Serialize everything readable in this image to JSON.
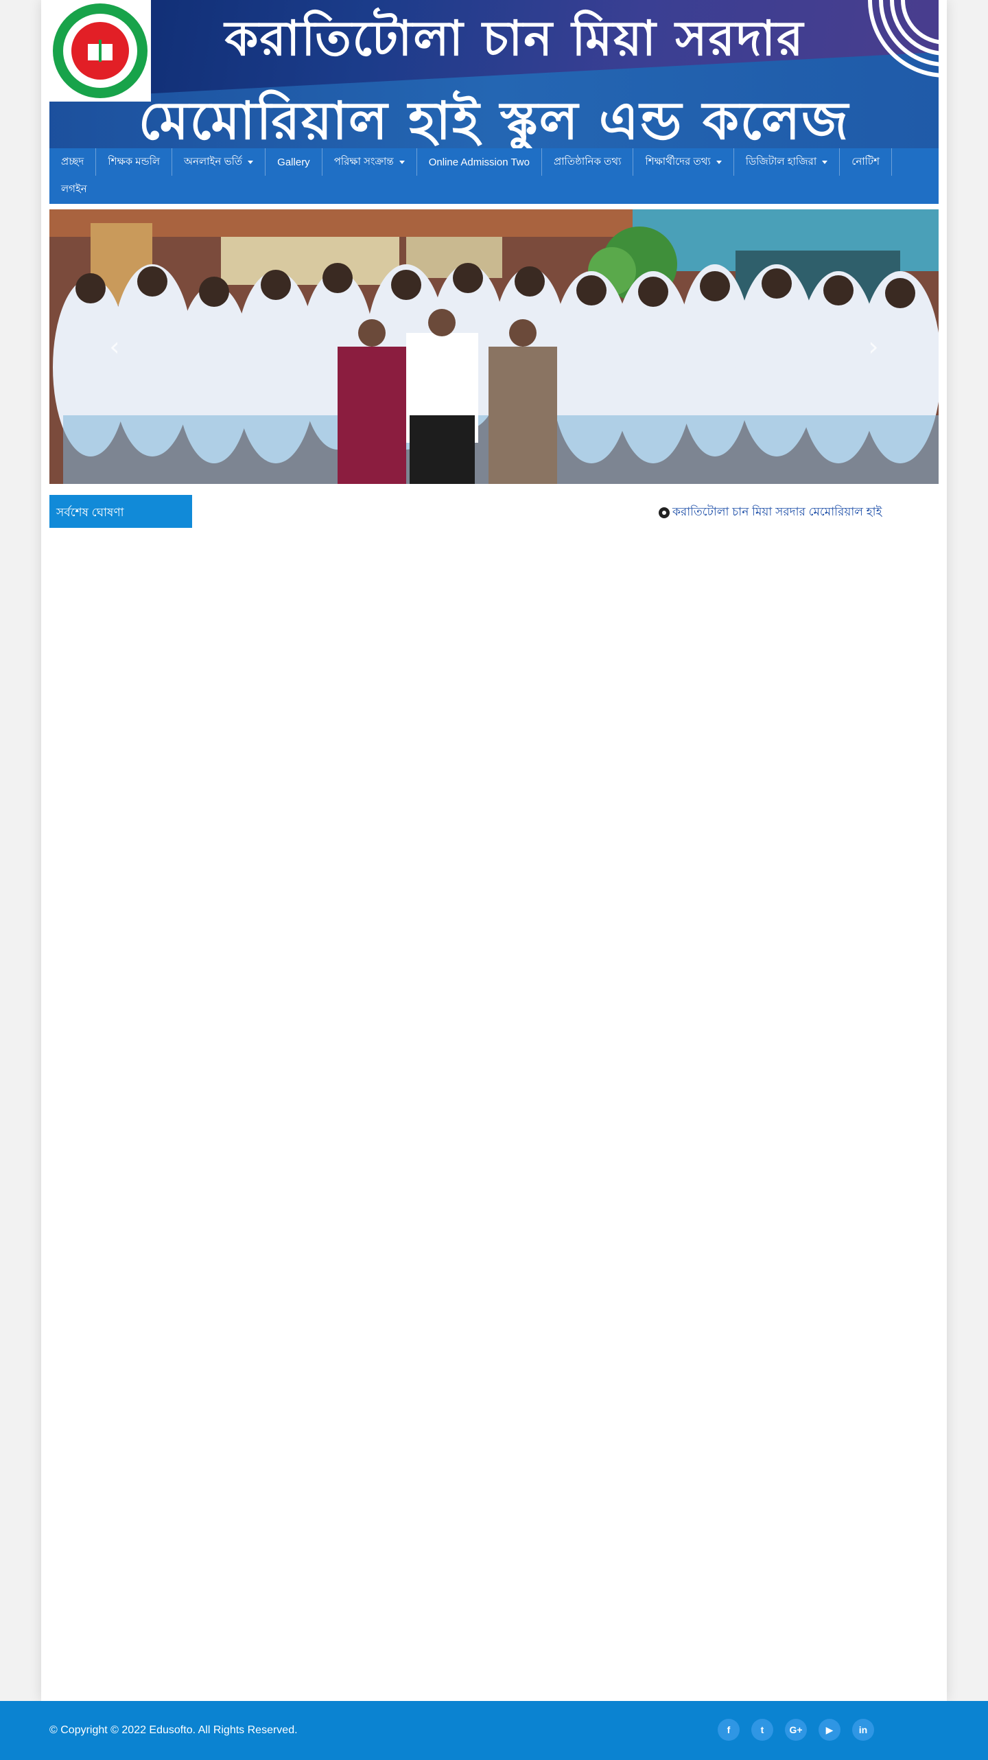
{
  "header": {
    "title_line1": "করাতিটোলা চান মিয়া সরদার",
    "title_line2": "মেমোরিয়াল হাই স্কুল এন্ড কলেজ",
    "logo_icon": "school-seal-logo"
  },
  "nav": {
    "items": [
      {
        "label": "প্রচ্ছদ",
        "dropdown": false
      },
      {
        "label": "শিক্ষক মন্ডলি",
        "dropdown": false
      },
      {
        "label": "অনলাইন ভর্তি",
        "dropdown": true
      },
      {
        "label": "Gallery",
        "dropdown": false
      },
      {
        "label": "পরিক্ষা সংক্রান্ত",
        "dropdown": true
      },
      {
        "label": "Online Admission Two",
        "dropdown": false
      },
      {
        "label": "প্রাতিষ্ঠানিক তথ্য",
        "dropdown": false
      },
      {
        "label": "শিক্ষার্থীদের তথ্য",
        "dropdown": true
      },
      {
        "label": "ডিজিটাল হাজিরা",
        "dropdown": true
      },
      {
        "label": "নোটিশ",
        "dropdown": false
      }
    ],
    "login": "লগইন"
  },
  "carousel": {
    "prev_icon": "chevron-left-icon",
    "next_icon": "chevron-right-icon",
    "prev_glyph": "‹",
    "next_glyph": "›"
  },
  "notice": {
    "label": "সর্বশেষ ঘোষণা",
    "ticker_text": "করাতিটোলা চান মিয়া সরদার মেমোরিয়াল হাই"
  },
  "footer": {
    "copyright": "© Copyright © 2022 Edusofto. All Rights Reserved.",
    "social": [
      {
        "icon": "facebook-icon",
        "glyph": "f"
      },
      {
        "icon": "twitter-icon",
        "glyph": "t"
      },
      {
        "icon": "google-plus-icon",
        "glyph": "G+"
      },
      {
        "icon": "youtube-icon",
        "glyph": "▶"
      },
      {
        "icon": "linkedin-icon",
        "glyph": "in"
      }
    ]
  },
  "colors": {
    "nav_bg": "#1f6fc5",
    "notice_label_bg": "#118ad8",
    "footer_bg": "#0b83d1",
    "ticker_text": "#1e4fa8"
  }
}
